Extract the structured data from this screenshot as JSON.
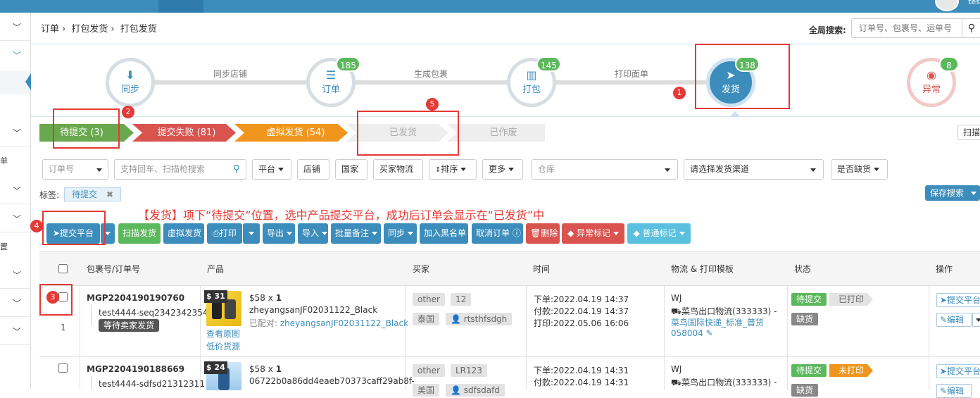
{
  "topbar": {
    "user": "tes"
  },
  "breadcrumb": [
    "订单",
    "打包发货",
    "打包发货"
  ],
  "global_search": {
    "label": "全局搜索:",
    "placeholder": "订单号、包裹号、运单号"
  },
  "workflow": {
    "steps": [
      {
        "label": "同步",
        "badge": ""
      },
      {
        "label": "订单",
        "badge": "185"
      },
      {
        "label": "打包",
        "badge": "145"
      },
      {
        "label": "发货",
        "badge": "138"
      },
      {
        "label": "异常",
        "badge": "8"
      }
    ],
    "connectors": [
      "同步店铺",
      "生成包裹",
      "打印面单"
    ]
  },
  "status_tabs": [
    "待提交 (3)",
    "提交失败 (81)",
    "虚拟发货 (54)",
    "已发货",
    "已作废"
  ],
  "scan_button": "扫描",
  "filters": {
    "order_no": "订单号",
    "search_placeholder": "支持回车、扫描枪搜索",
    "platform": "平台",
    "shop": "店铺",
    "country": "国家",
    "buyer_logistics": "买家物流",
    "sort": "排序",
    "more": "更多",
    "warehouse": "仓库",
    "channel": "请选择发货渠道",
    "stockout": "是否缺货"
  },
  "tags_row": {
    "label": "标签:",
    "active_tag": "待提交"
  },
  "save_search": "保存搜索",
  "annotation": "【发货】项下“待提交”位置，选中产品提交平台，成功后订单会显示在“已发货”中",
  "markers": [
    "1",
    "2",
    "3",
    "4",
    "5"
  ],
  "actions": [
    "提交平台",
    "扫描发货",
    "虚拟发货",
    "打印",
    "导出",
    "导入",
    "批量备注",
    "同步",
    "加入黑名单",
    "取消订单",
    "删除",
    "异常标记",
    "普通标记"
  ],
  "table": {
    "headers": [
      "包裹号/订单号",
      "产品",
      "买家",
      "时间",
      "物流 & 打印模板",
      "状态",
      "操作"
    ],
    "rows": [
      {
        "package": "MGP2204190190760",
        "order": "test4444-seq2342342354",
        "wait_tag": "等待卖家发货",
        "index": "1",
        "price_badge": "$ 31",
        "price": "$58 x",
        "qty": "1",
        "sku": "zheyangsanJF02031122_Black",
        "matched_label": "已配对:",
        "matched_sku": "zheyangsanJF02031122_Black",
        "view_image": "查看原图",
        "low_price": "低价货源",
        "buyer_tags": [
          "other",
          "12",
          "泰国",
          "rtsthfsdgh"
        ],
        "time_order": "下单:2022.04.19 14:37",
        "time_pay": "付款:2022.04.19 14:37",
        "time_print": "打印:2022.05.06 16:06",
        "logistics_code": "WJ",
        "logistics_name": "菜鸟出口物流(333333) -",
        "logistics_template": "菜鸟国际快递_标准_普货",
        "logistics_id": "058004",
        "status": [
          "待提交",
          "已打印",
          "缺货"
        ],
        "ops": [
          "提交平台",
          "编辑"
        ]
      },
      {
        "package": "MGP2204190188669",
        "order": "test4444-sdfsd21312311",
        "price_badge": "$ 24",
        "price": "$58 x",
        "qty": "1",
        "sku": "06722b0a86dd4eaeb70373caff29ab8f-",
        "buyer_tags": [
          "other",
          "LR123",
          "美国",
          "sdfsdafd"
        ],
        "time_order": "下单:2022.04.19 14:31",
        "time_pay": "付款:2022.04.19 14:31",
        "logistics_code": "WJ",
        "logistics_name": "菜鸟出口物流(333333) -",
        "status": [
          "待提交",
          "未打印",
          "缺货"
        ],
        "ops": [
          "提交平台",
          "编辑"
        ]
      }
    ]
  },
  "leftnav_fragments": [
    "单",
    "置"
  ],
  "colors": {
    "primary": "#3c8dbc",
    "green": "#5cb85c",
    "red": "#d9534f",
    "orange": "#f0ad4e",
    "annotation": "#e53935"
  }
}
